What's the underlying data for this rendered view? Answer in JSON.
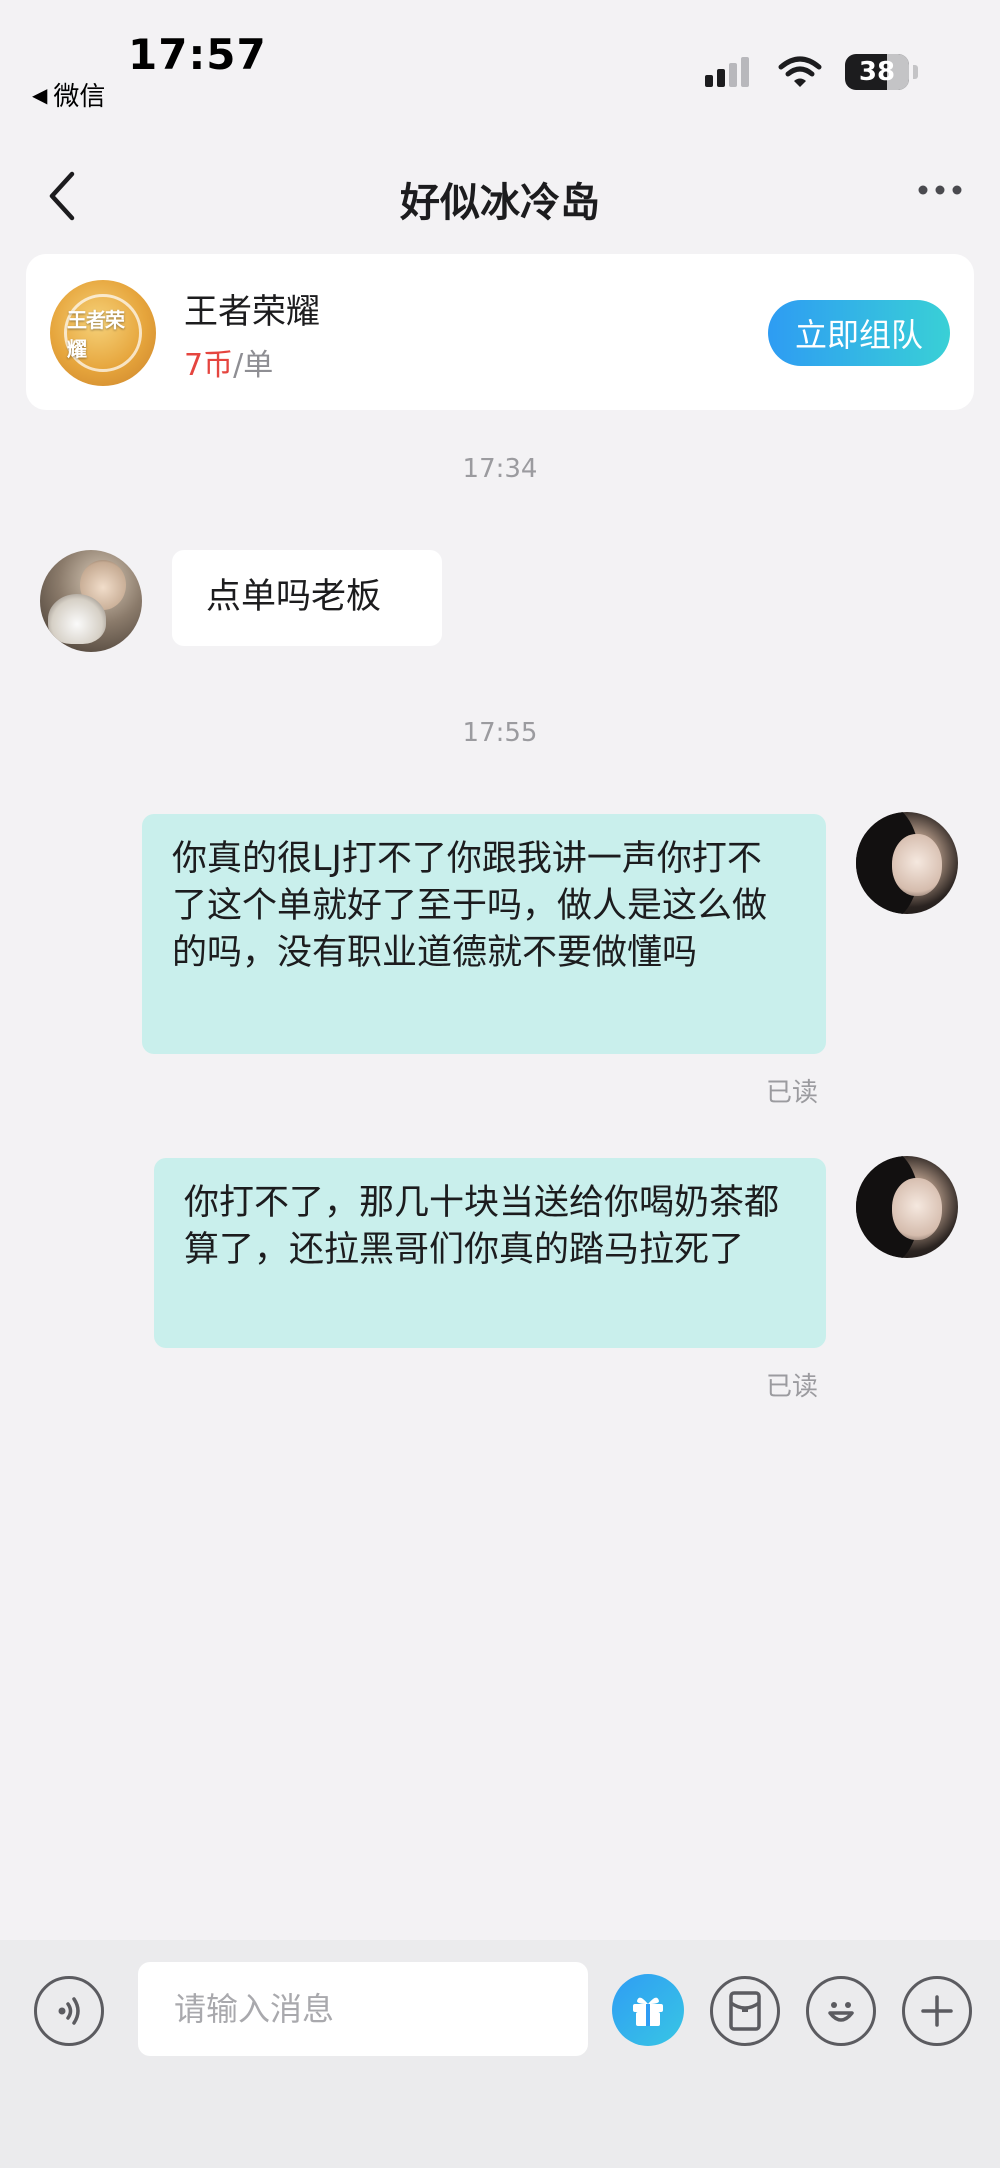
{
  "status_bar": {
    "time": "17:57",
    "back_app_label": "微信",
    "battery_level": "38"
  },
  "nav": {
    "title": "好似冰冷岛"
  },
  "game_card": {
    "game_name": "王者荣耀",
    "logo_text": "王者荣耀",
    "price": "7币",
    "unit": "/单",
    "team_button_label": "立即组队"
  },
  "chat": {
    "messages": [
      {
        "timestamp": "17:34",
        "side": "left",
        "text": "点单吗老板"
      },
      {
        "timestamp": "17:55",
        "side": "right",
        "text": "你真的很LJ打不了你跟我讲一声你打不了这个单就好了至于吗，做人是这么做的吗，没有职业道德就不要做懂吗",
        "read": "已读"
      },
      {
        "side": "right",
        "text": "你打不了，那几十块当送给你喝奶茶都算了，还拉黑哥们你真的踏马拉死了",
        "read": "已读"
      }
    ]
  },
  "input_bar": {
    "placeholder": "请输入消息"
  },
  "colors": {
    "accent": "#2e9cf3",
    "bubble_self": "#c9efec",
    "price_red": "#e5453f"
  },
  "icons": [
    "voice-icon",
    "gift-icon",
    "red-envelope-icon",
    "emoji-icon",
    "plus-icon"
  ]
}
